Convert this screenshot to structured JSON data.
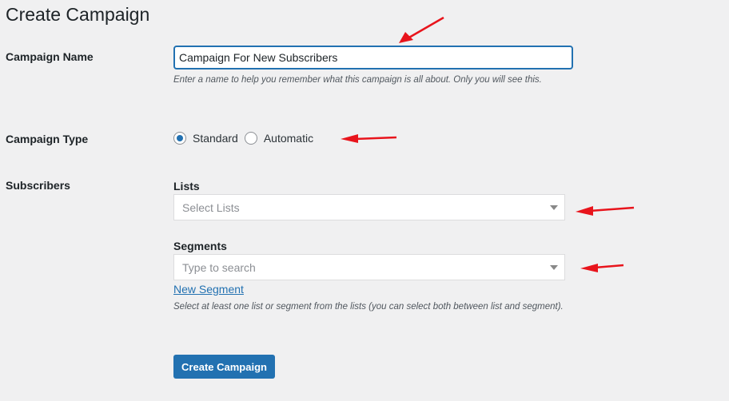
{
  "page": {
    "title": "Create Campaign"
  },
  "campaign_name": {
    "label": "Campaign Name",
    "value": "Campaign For New Subscribers",
    "help": "Enter a name to help you remember what this campaign is all about. Only you will see this."
  },
  "campaign_type": {
    "label": "Campaign Type",
    "options": [
      {
        "label": "Standard",
        "checked": true
      },
      {
        "label": "Automatic",
        "checked": false
      }
    ]
  },
  "subscribers": {
    "label": "Subscribers",
    "lists": {
      "label": "Lists",
      "placeholder": "Select Lists"
    },
    "segments": {
      "label": "Segments",
      "placeholder": "Type to search"
    },
    "new_segment_link": "New Segment",
    "help": "Select at least one list or segment from the lists (you can select both between list and segment)."
  },
  "submit": {
    "label": "Create Campaign"
  },
  "colors": {
    "accent": "#2271b1",
    "annotation_arrow": "#e8141c"
  }
}
